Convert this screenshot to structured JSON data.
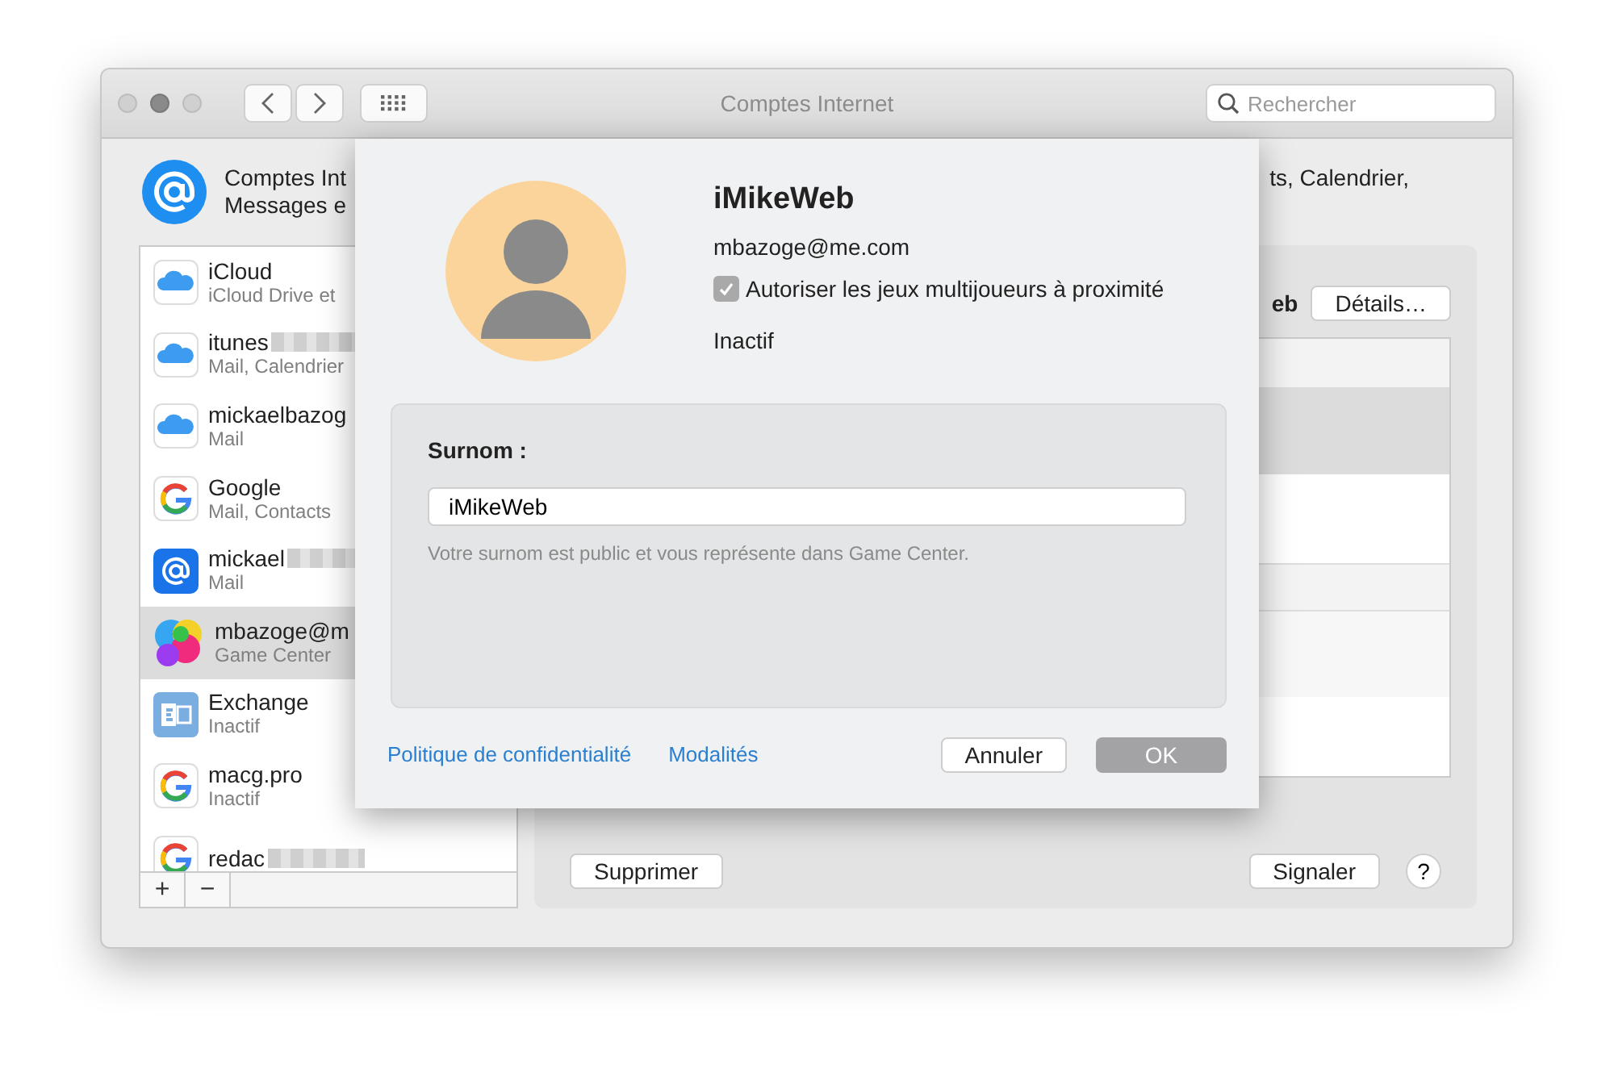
{
  "window": {
    "title": "Comptes Internet",
    "search": {
      "placeholder": "Rechercher"
    }
  },
  "header": {
    "left_lines": [
      "Comptes Int",
      "Messages e"
    ],
    "right_text": "ts, Calendrier,"
  },
  "accounts": [
    {
      "name": "iCloud",
      "detail": "iCloud Drive et",
      "kind": "icloud",
      "redacted": false,
      "selected": false
    },
    {
      "name": "itunes",
      "detail": "Mail, Calendrier",
      "kind": "icloud",
      "redacted": true,
      "selected": false
    },
    {
      "name": "mickaelbazog",
      "detail": "Mail",
      "kind": "icloud",
      "redacted": false,
      "selected": false
    },
    {
      "name": "Google",
      "detail": "Mail, Contacts",
      "kind": "google",
      "redacted": false,
      "selected": false
    },
    {
      "name": "mickael",
      "detail": "Mail",
      "kind": "mail",
      "redacted": true,
      "selected": false
    },
    {
      "name": "mbazoge@m",
      "detail": "Game Center",
      "kind": "gamecenter",
      "redacted": false,
      "selected": true
    },
    {
      "name": "Exchange",
      "detail": "Inactif",
      "kind": "exchange",
      "redacted": false,
      "selected": false
    },
    {
      "name": "macg.pro",
      "detail": "Inactif",
      "kind": "google",
      "redacted": false,
      "selected": false
    },
    {
      "name": "redac",
      "kind": "google",
      "redacted": true,
      "selected": false
    }
  ],
  "list_buttons": [
    "+",
    "−"
  ],
  "detail_pane": {
    "name_fragment": "eb",
    "details_button": "Détails…",
    "delete_button": "Supprimer",
    "report_button": "Signaler",
    "help_button": "?"
  },
  "sheet": {
    "nickname_title": "iMikeWeb",
    "email": "mbazoge@me.com",
    "multiplayer": {
      "label": "Autoriser les jeux multijoueurs à proximité",
      "checked": true
    },
    "status": "Inactif",
    "nickname_label": "Surnom :",
    "nickname_value": "iMikeWeb",
    "hint": "Votre surnom est public et vous représente dans Game Center.",
    "links": [
      "Politique de confidentialité",
      "Modalités"
    ],
    "cancel_button": "Annuler",
    "ok_button": "OK"
  }
}
